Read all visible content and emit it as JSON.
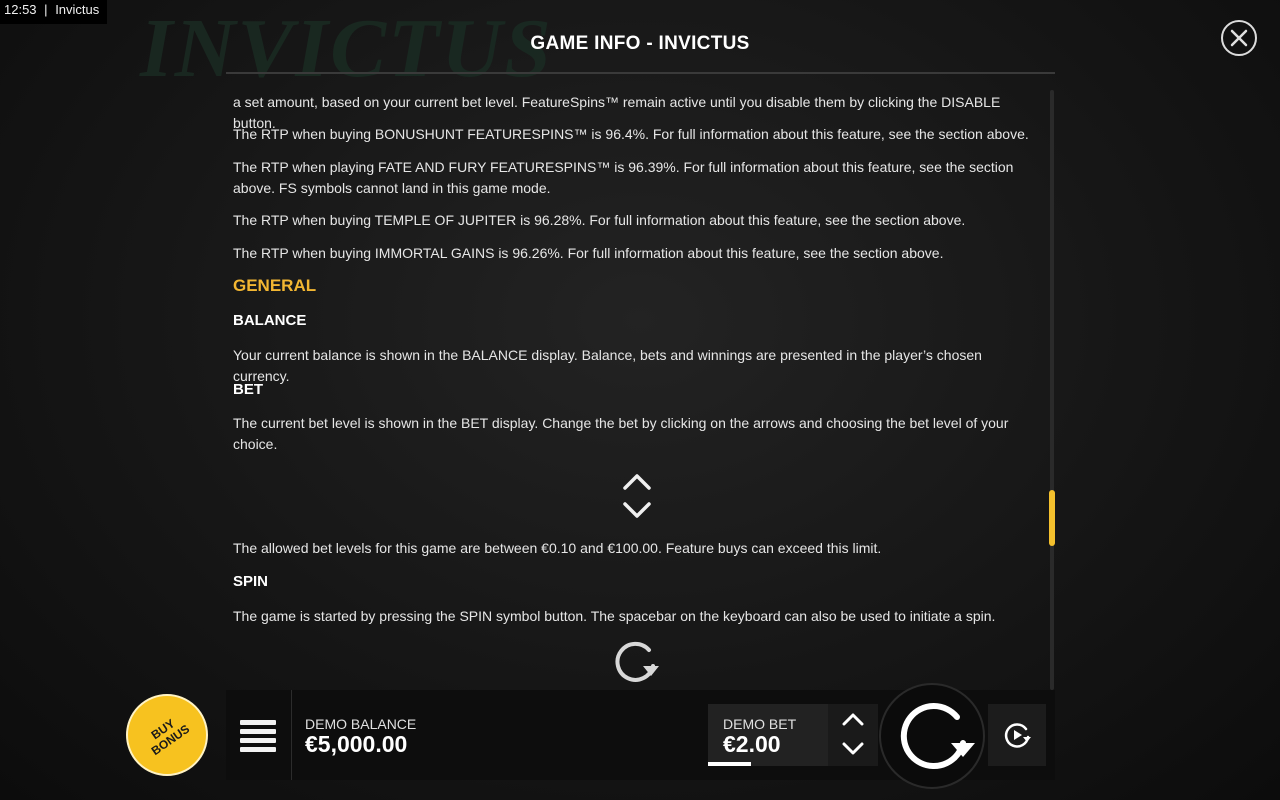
{
  "status": {
    "time": "12:53",
    "app_name": "Invictus"
  },
  "background": {
    "logo_text": "INVICTUS"
  },
  "header": {
    "title": "GAME INFO - INVICTUS"
  },
  "paragraphs": {
    "p1": "a set amount, based on your current bet level. FeatureSpins™ remain active until you disable them by clicking the DISABLE button.",
    "p2": "The RTP when buying BONUSHUNT FEATURESPINS™ is 96.4%. For full information about this feature, see the section above.",
    "p3": "The RTP when playing FATE AND FURY FEATURESPINS™ is 96.39%. For full information about this feature, see the section above. FS symbols cannot land in this game mode.",
    "p4": "The RTP when buying TEMPLE OF JUPITER is 96.28%. For full information about this feature, see the section above.",
    "p5": "The RTP when buying IMMORTAL GAINS is 96.26%. For full information about this feature, see the section above."
  },
  "general": {
    "title": "GENERAL",
    "balance_title": "BALANCE",
    "balance_text": "Your current balance is shown in the BALANCE display. Balance, bets and winnings are presented in the player’s chosen currency.",
    "bet_title": "BET",
    "bet_text": "The current bet level is shown in the BET display. Change the bet by clicking on the arrows and choosing the bet level of your choice.",
    "bet_limits_text": "The allowed bet levels for this game are between €0.10 and €100.00. Feature buys can exceed this limit.",
    "spin_title": "SPIN",
    "spin_text": "The game is started by pressing the SPIN symbol button. The spacebar on the keyboard can also be used to initiate a spin."
  },
  "bottom_bar": {
    "buy_bonus_label": "BUY BONUS",
    "balance_label": "DEMO BALANCE",
    "balance_value": "€5,000.00",
    "bet_label": "DEMO BET",
    "bet_value": "€2.00"
  },
  "colors": {
    "accent": "#f2b632",
    "buy_bonus": "#f7c21f",
    "background": "#111111"
  },
  "icons": [
    "close-icon",
    "chevron-up-icon",
    "chevron-down-icon",
    "spin-icon",
    "menu-icon",
    "autoplay-icon"
  ],
  "scroll": {
    "position_fraction": 0.72
  }
}
